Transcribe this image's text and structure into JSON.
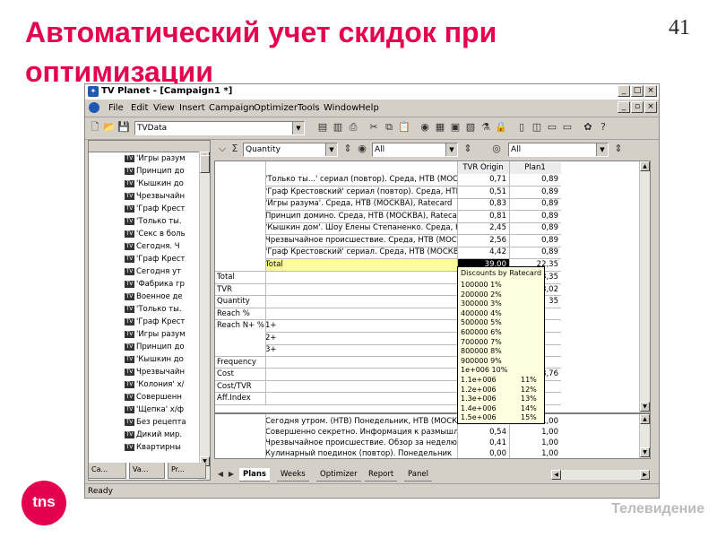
{
  "slide": {
    "title": "Автоматический учет скидок при оптимизации",
    "page_number": "41",
    "logo": "tns",
    "footer": "Телевидение"
  },
  "window": {
    "title": "TV Planet - [Campaign1 *]",
    "menu": [
      "File",
      "Edit",
      "View",
      "Insert",
      "Campaign",
      "Optimizer",
      "Tools",
      "Window",
      "Help"
    ],
    "toolbar_combo": "TVData",
    "status": "Ready"
  },
  "filters": {
    "measure": "Quantity",
    "filter1": "All",
    "filter2": "All",
    "sigma_icon": "sigma-icon"
  },
  "tree": {
    "items": [
      "'Игры разум",
      "Принцип до",
      "'Кышкин до",
      "Чрезвычайн",
      "'Граф Крест",
      "'Только ты.",
      "'Секс в боль",
      "Сегодня. Ч",
      "'Граф Крест",
      "Сегодня ут",
      "'Фабрика гр",
      "Военное де",
      "'Только ты.",
      "'Граф Крест",
      "'Игры разум",
      "Принцип до",
      "'Кышкин до",
      "Чрезвычайн",
      "'Колония' х/",
      "Совершенн",
      "'Щепка' х/ф",
      "Без рецепта",
      "Дикий мир.",
      "Квартирны"
    ],
    "tabs": [
      "Ca...",
      "Va...",
      "Pr..."
    ]
  },
  "grid": {
    "columns": [
      "TVR Origin",
      "Plan1"
    ],
    "rows": [
      {
        "label": "'Только ты...' сериал (повтор). Среда, НТВ (МОСКВ",
        "tvr": "0,71",
        "plan": "0,89"
      },
      {
        "label": "'Граф Крестовский' сериал (повтор). Среда, НТВ (",
        "tvr": "0,51",
        "plan": "0,89"
      },
      {
        "label": "'Игры разума'. Среда, НТВ (МОСКВА), Ratecard",
        "tvr": "0,83",
        "plan": "0,89"
      },
      {
        "label": "Принцип домино. Среда, НТВ (МОСКВА), Ratecard",
        "tvr": "0,81",
        "plan": "0,89"
      },
      {
        "label": "'Кышкин дом'. Шоу Елены Степаненко. Среда, НТВ",
        "tvr": "2,45",
        "plan": "0,89"
      },
      {
        "label": "Чрезвычайное происшествие. Среда, НТВ (МОСКВА)",
        "tvr": "2,56",
        "plan": "0,89"
      },
      {
        "label": "'Граф Крестовский' сериал. Среда, НТВ (МОСКВА)",
        "tvr": "4,42",
        "plan": "0,89"
      }
    ],
    "total_row": {
      "label": "Total",
      "tvr": "39,00",
      "plan": "22,35"
    },
    "summary_labels": [
      "Total",
      "TVR",
      "Quantity",
      "Reach %",
      "Reach N+ %",
      "Frequency",
      "Cost",
      "Cost/TVR",
      "Aff.Index"
    ],
    "reach_levels": [
      "1+",
      "2+",
      "3+"
    ],
    "summary_values": {
      "Total": "23,35",
      "TVR": "23,02",
      "Quantity": "35",
      "Cost": "3,76"
    },
    "bottom_rows": [
      {
        "label": "Сегодня утром. (НТВ) Понедельник, НТВ (МОСКВА)",
        "tvr": "",
        "plan": "1,00"
      },
      {
        "label": "Совершенно секретно. Информация к размышлению",
        "tvr": "0,54",
        "plan": "1,00"
      },
      {
        "label": "Чрезвычайное происшествие. Обзор за неделю.",
        "tvr": "0,41",
        "plan": "1,00"
      },
      {
        "label": "Кулинарный поединок (повтор). Понедельник",
        "tvr": "0,00",
        "plan": "1,00"
      }
    ]
  },
  "tooltip": {
    "title": "Discounts by Ratecard",
    "rows": [
      {
        "k": "100000 1%",
        "v": ""
      },
      {
        "k": "200000 2%",
        "v": ""
      },
      {
        "k": "300000 3%",
        "v": ""
      },
      {
        "k": "400000 4%",
        "v": ""
      },
      {
        "k": "500000 5%",
        "v": ""
      },
      {
        "k": "600000 6%",
        "v": ""
      },
      {
        "k": "700000 7%",
        "v": ""
      },
      {
        "k": "800000 8%",
        "v": ""
      },
      {
        "k": "900000 9%",
        "v": ""
      },
      {
        "k": "1e+006 10%",
        "v": ""
      },
      {
        "k": "1.1e+006",
        "v": "11%"
      },
      {
        "k": "1.2e+006",
        "v": "12%"
      },
      {
        "k": "1.3e+006",
        "v": "13%"
      },
      {
        "k": "1.4e+006",
        "v": "14%"
      },
      {
        "k": "1.5e+006",
        "v": "15%"
      }
    ]
  },
  "bottom_tabs": [
    "Plans",
    "Weeks",
    "Optimizer",
    "Report",
    "Panel"
  ]
}
